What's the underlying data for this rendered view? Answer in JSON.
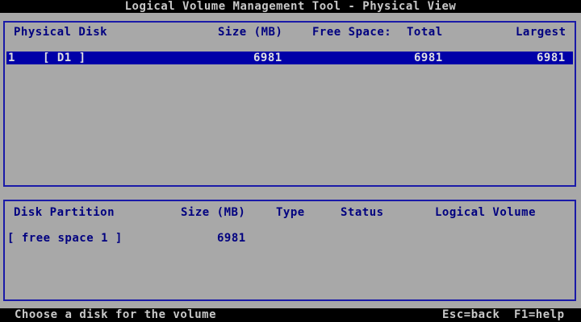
{
  "window": {
    "title": "Logical Volume Management Tool - Physical View"
  },
  "disks_panel": {
    "headers": {
      "physical_disk": "Physical Disk",
      "size_mb": "Size (MB)",
      "free_space": "Free Space:",
      "total": "Total",
      "largest": "Largest"
    },
    "rows": [
      {
        "index": "1",
        "name": "[ D1 ]",
        "size": "6981",
        "total": "6981",
        "largest": "6981",
        "selected": true
      }
    ]
  },
  "partitions_panel": {
    "headers": {
      "disk_partition": "Disk Partition",
      "size_mb": "Size (MB)",
      "type": "Type",
      "status": "Status",
      "logical_volume": "Logical Volume"
    },
    "rows": [
      {
        "name": "[ free space 1 ]",
        "size": "6981",
        "type": "",
        "status": "",
        "logical_volume": ""
      }
    ]
  },
  "status_bar": {
    "message": "Choose a disk for the volume",
    "hint_back": "Esc=back",
    "hint_help": "F1=help"
  },
  "colors": {
    "background": "#a8a8a8",
    "panel_border": "#1a1aa8",
    "text": "#000080",
    "selection_bg": "#0000a8",
    "bar_bg": "#000000"
  }
}
